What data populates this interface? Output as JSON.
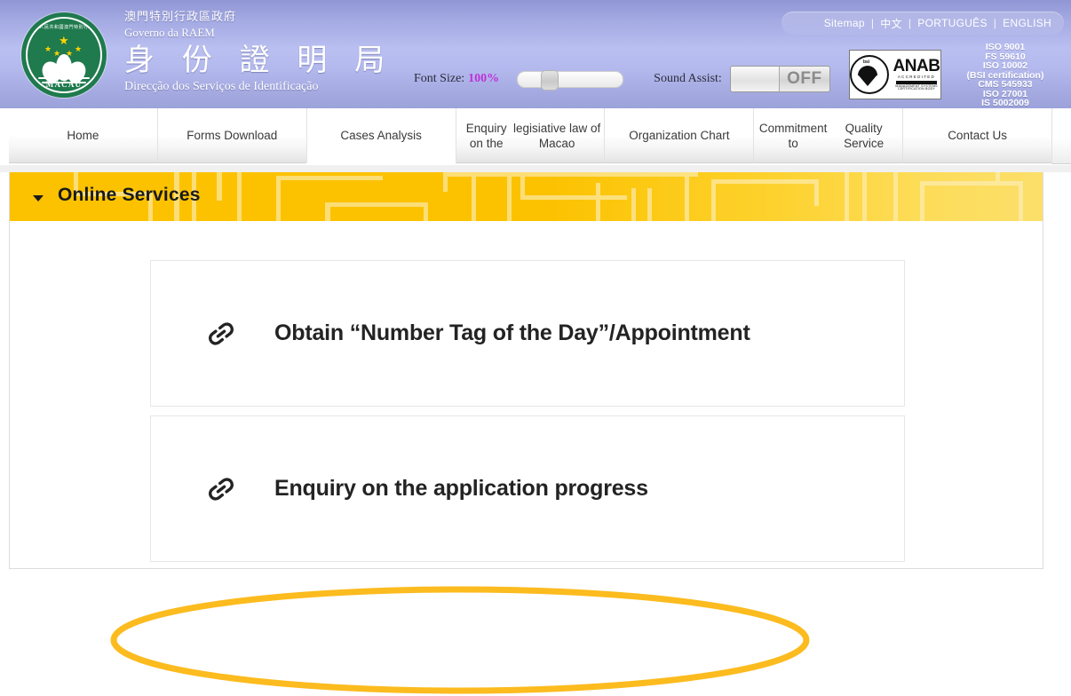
{
  "header": {
    "emblem": {
      "top_text": "中華人民共和國澳門特別行政區",
      "bottom_text": "MACAU"
    },
    "dept": {
      "zh_small": "澳門特別行政區政府",
      "pt_small": "Governo da RAEM",
      "zh_big": "身 份 證 明 局",
      "pt_big": "Direcção dos Serviços de Identificação"
    },
    "lang_bar": {
      "sitemap": "Sitemap",
      "chinese": "中文",
      "portuguese": "PORTUGUÊS",
      "english": "ENGLISH",
      "separator": "|"
    },
    "controls": {
      "font_size_label": "Font Size:",
      "font_size_value": "100%",
      "font_size_accent_color": "#c030d8",
      "sound_assist_label": "Sound Assist:",
      "sound_assist_state": "OFF"
    },
    "certs": {
      "bsi_mark": "bsi",
      "anab_name": "ANAB",
      "anab_sub": "ACCREDITED",
      "anab_foot": "MANAGEMENT SYSTEMS CERTIFICATION BODY",
      "iso_lines": [
        "ISO  9001",
        "FS 59610",
        "ISO  10002",
        "(BSI certification)",
        "CMS  545933",
        "ISO  27001",
        "IS  5002009"
      ]
    }
  },
  "nav": {
    "items": [
      {
        "label": "Home",
        "active": false
      },
      {
        "label": "Forms Download",
        "active": false
      },
      {
        "label": "Cases Analysis",
        "active": true
      },
      {
        "label": "Enquiry on the\nlegisiative law of Macao",
        "active": false
      },
      {
        "label": "Organization Chart",
        "active": false
      },
      {
        "label": "Commitment to\nQuality Service",
        "active": false
      },
      {
        "label": "Contact Us",
        "active": false
      }
    ]
  },
  "main": {
    "banner": {
      "title": "Online Services",
      "accent_color": "#fcc200",
      "caret": "caret-down"
    },
    "services": [
      {
        "icon": "link-icon",
        "label": "Obtain “Number Tag of the Day”/Appointment",
        "highlighted": false
      },
      {
        "icon": "link-icon",
        "label": "Enquiry on the application progress",
        "highlighted": true
      }
    ],
    "annotation": {
      "shape": "ellipse",
      "color": "#fcbb1e",
      "target": "Enquiry on the application progress"
    }
  }
}
